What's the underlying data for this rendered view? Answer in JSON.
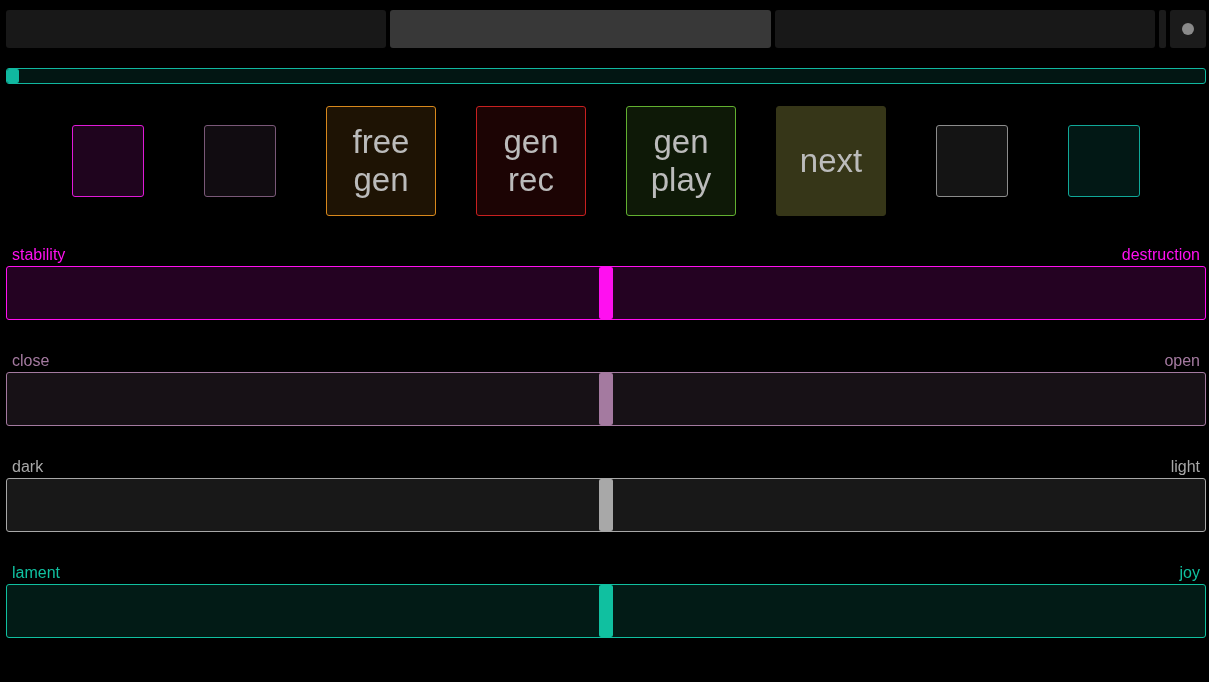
{
  "tabs": [
    {
      "selected": false
    },
    {
      "selected": true
    },
    {
      "selected": false
    }
  ],
  "progress": {
    "level": 0.006,
    "color": "#10b8a0"
  },
  "buttons": [
    {
      "color": "#e01ad8",
      "on": false
    },
    {
      "color": "#7a5878",
      "on": false
    },
    {
      "label": "free\ngen",
      "color": "#d8881c",
      "on": false
    },
    {
      "label": "gen\nrec",
      "color": "#c82020",
      "on": false
    },
    {
      "label": "gen\nplay",
      "color": "#62b030",
      "on": false
    },
    {
      "label": "next",
      "color": "#363618",
      "on": true
    },
    {
      "color": "#8c8c8c",
      "on": false
    },
    {
      "color": "#10a898",
      "on": false
    }
  ],
  "sliders": [
    {
      "left": "stability",
      "right": "destruction",
      "color": "#ff10f0",
      "level": 0.5
    },
    {
      "left": "close",
      "right": "open",
      "color": "#a47aa0",
      "level": 0.5
    },
    {
      "left": "dark",
      "right": "light",
      "color": "#a8a8a8",
      "level": 0.5
    },
    {
      "left": "lament",
      "right": "joy",
      "color": "#10c0a0",
      "level": 0.5
    }
  ]
}
